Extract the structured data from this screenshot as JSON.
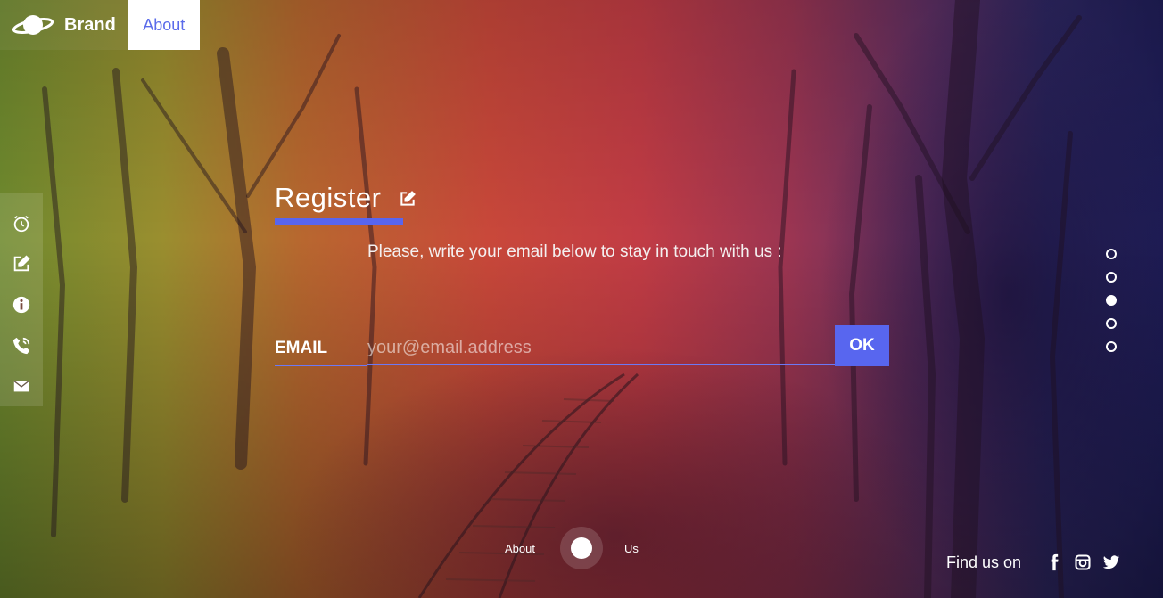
{
  "navbar": {
    "brand_label": "Brand",
    "about_label": "About",
    "brand_icon": "planet-icon"
  },
  "side_nav": {
    "items": [
      {
        "icon": "alarm-clock-icon"
      },
      {
        "icon": "edit-icon"
      },
      {
        "icon": "info-icon"
      },
      {
        "icon": "phone-icon"
      },
      {
        "icon": "envelope-icon"
      }
    ]
  },
  "register": {
    "title": "Register",
    "title_icon": "edit-icon",
    "subtitle": "Please, write your email below to stay in touch with us :",
    "email_label": "EMAIL",
    "email_placeholder": "your@email.address",
    "email_value": "",
    "ok_label": "OK"
  },
  "pager": {
    "count": 5,
    "active_index": 2
  },
  "bottom_toggle": {
    "left_label": "About",
    "right_label": "Us"
  },
  "footer": {
    "find_us_label": "Find us on",
    "social_icons": [
      "facebook-icon",
      "instagram-icon",
      "twitter-icon"
    ]
  },
  "colors": {
    "accent": "#5865ef",
    "nav_active_bg": "#ffffff",
    "nav_active_text": "#5a6bea"
  }
}
